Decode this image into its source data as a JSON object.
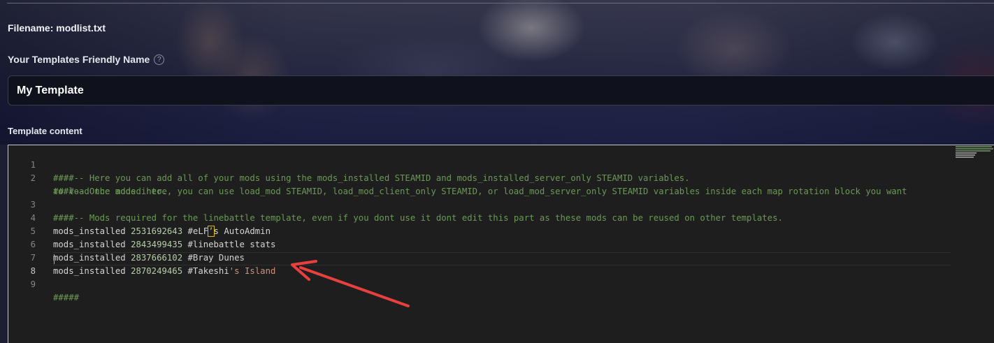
{
  "header": {
    "filename": "Filename: modlist.txt"
  },
  "template_name": {
    "label": "Your Templates Friendly Name",
    "help_icon": "question-circle-icon",
    "value": "My Template"
  },
  "template_content": {
    "label": "Template content"
  },
  "editor": {
    "line_numbers": [
      "1",
      "2",
      "3",
      "4",
      "5",
      "6",
      "7",
      "8",
      "9"
    ],
    "comment_line1": "####-- Here you can add all of your mods using the mods_installed STEAMID and mods_installed_server_only STEAMID variables.",
    "comment_line2a": "####-- Once added here, you can use load_mod STEAMID, load_mod_client_only STEAMID, or load_mod_server_only STEAMID variables inside each map rotation block you want",
    "comment_line2b": "to load the mods into.",
    "comment_line3": "####-- Mods required for the linebattle template, even if you dont use it dont edit this part as these mods can be reused on other templates.",
    "mod1": {
      "keyword": "mods_installed",
      "id": "2531692643",
      "c1": "#eLF",
      "c2": "’",
      "c3": "s AutoAdmin"
    },
    "mod2": {
      "keyword": "mods_installed",
      "id": "2843499435",
      "comment": "#linebattle stats"
    },
    "mod3": {
      "keyword": "mods_installed",
      "id": "2837666102",
      "comment": "#Bray Dunes"
    },
    "mod4": {
      "keyword": "mods_installed",
      "id": "2870249465",
      "c1": "#Takeshi",
      "c2": "'s Island"
    },
    "footer_comment": "#####"
  },
  "colors": {
    "comment": "#6a9955",
    "number": "#b5cea8",
    "string": "#ce9178",
    "annotation_arrow": "#e8403e"
  }
}
